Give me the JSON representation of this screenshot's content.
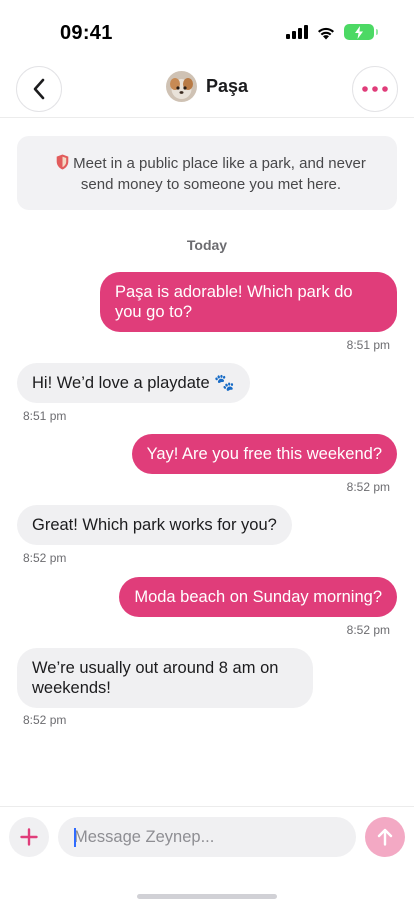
{
  "status": {
    "time": "09:41"
  },
  "header": {
    "name": "Paşa"
  },
  "safety": {
    "text": "Meet in a public place like a park, and never send money to someone you met here."
  },
  "conversation": {
    "day_label": "Today",
    "messages": [
      {
        "text": "Paşa is adorable! Which park do you go to?",
        "time": "8:51 pm"
      },
      {
        "text": "Hi! We’d love a playdate 🐾",
        "time": "8:51 pm"
      },
      {
        "text": "Yay! Are you free this weekend?",
        "time": "8:52 pm"
      },
      {
        "text": "Great! Which park works for you?",
        "time": "8:52 pm"
      },
      {
        "text": "Moda beach on Sunday morning?",
        "time": "8:52 pm"
      },
      {
        "text": "We’re usually out around 8 am on weekends!",
        "time": "8:52 pm"
      }
    ]
  },
  "composer": {
    "placeholder": "Message Zeynep..."
  },
  "colors": {
    "accent": "#e03d7a",
    "send_disabled": "#f3a9c4",
    "incoming_bubble": "#f0f0f2"
  }
}
